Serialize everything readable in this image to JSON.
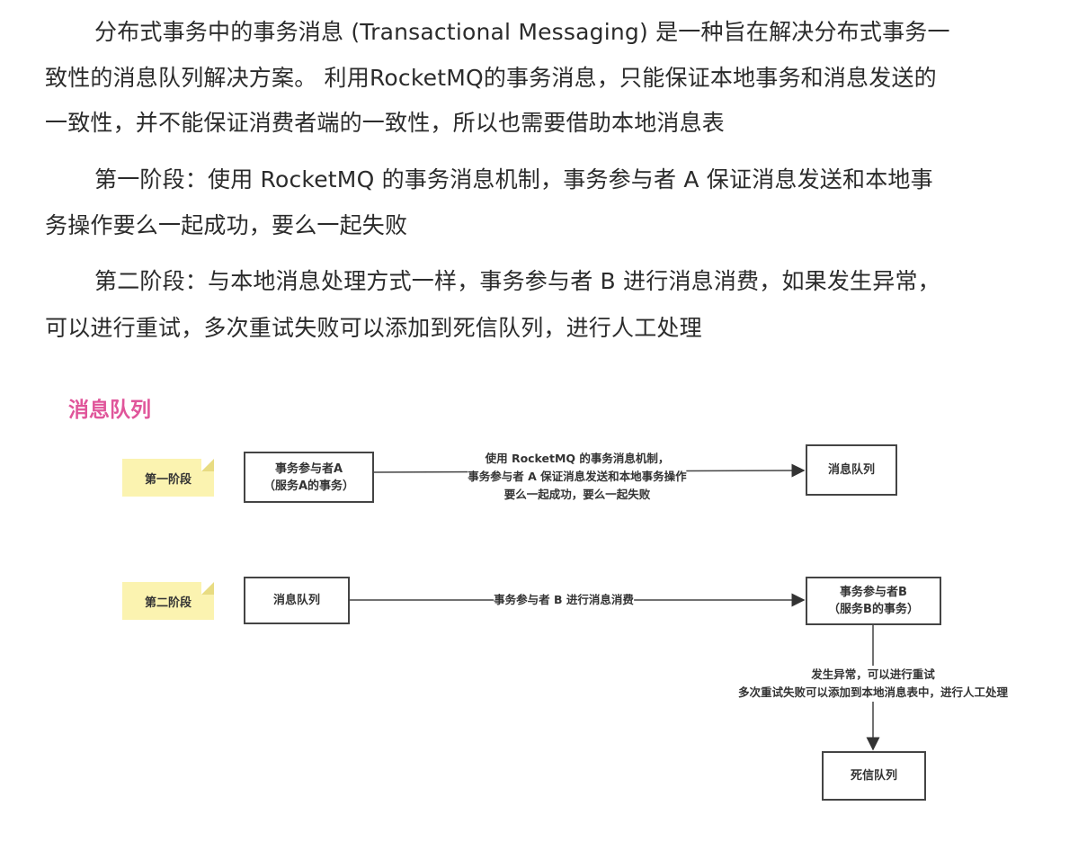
{
  "paragraphs": [
    {
      "lines": [
        "分布式事务中的事务消息 (Transactional Messaging) 是一种旨在解决分布式事务一",
        "致性的消息队列解决方案。 利用RocketMQ的事务消息，只能保证本地事务和消息发送的",
        "一致性，并不能保证消费者端的一致性，所以也需要借助本地消息表"
      ]
    },
    {
      "lines": [
        "第一阶段：使用 RocketMQ 的事务消息机制，事务参与者 A 保证消息发送和本地事",
        "务操作要么一起成功，要么一起失败"
      ]
    },
    {
      "lines": [
        "第二阶段：与本地消息处理方式一样，事务参与者 B 进行消息消费，如果发生异常，",
        "可以进行重试，多次重试失败可以添加到死信队列，进行人工处理"
      ]
    }
  ],
  "diagram": {
    "title": "消息队列",
    "title_color": "#e0559a",
    "phase1": {
      "note": "第一阶段",
      "source": [
        "事务参与者A",
        "（服务A的事务）"
      ],
      "edge_label": [
        "使用 RocketMQ 的事务消息机制，",
        "事务参与者 A 保证消息发送和本地事务操作",
        "要么一起成功，要么一起失败"
      ],
      "target": "消息队列"
    },
    "phase2": {
      "note": "第二阶段",
      "source": "消息队列",
      "edge_label": "事务参与者 B 进行消息消费",
      "target": [
        "事务参与者B",
        "（服务B的事务）"
      ],
      "down_label": [
        "发生异常，可以进行重试",
        "多次重试失败可以添加到本地消息表中，进行人工处理"
      ],
      "dead_letter": "死信队列"
    }
  }
}
